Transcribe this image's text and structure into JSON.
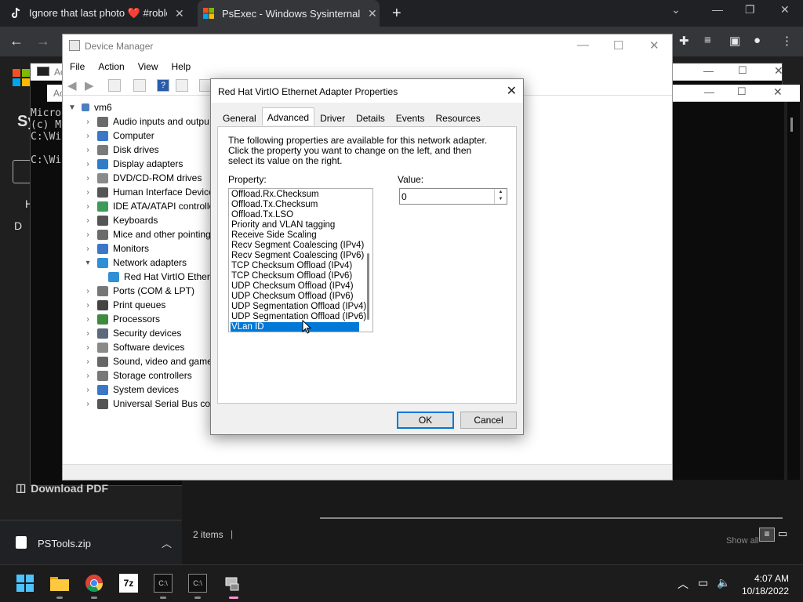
{
  "browser": {
    "tabs": [
      {
        "title": "Ignore that last photo ❤️ #roblo",
        "close": "✕"
      },
      {
        "title": "PsExec - Windows Sysinternals | M",
        "close": "✕"
      }
    ],
    "new_tab": "+"
  },
  "background": {
    "download_pdf": "Download PDF",
    "cmd_lines_1": "Micro\n(c) M\nC:\\Wi\n\nC:\\Wi",
    "cmd_title_1": "Ac",
    "cmd_title_2": "Ac",
    "explorer_status": "2 items",
    "show_all": "Show all",
    "shelf_file": "PSTools.zip",
    "sy": "Sy",
    "h": "H",
    "d": "D"
  },
  "device_manager": {
    "title": "Device Manager",
    "menu": [
      "File",
      "Action",
      "View",
      "Help"
    ],
    "tree": {
      "root": "vm6",
      "items": [
        {
          "label": "Audio inputs and outpu",
          "expanded": false
        },
        {
          "label": "Computer",
          "expanded": false
        },
        {
          "label": "Disk drives",
          "expanded": false
        },
        {
          "label": "Display adapters",
          "expanded": false
        },
        {
          "label": "DVD/CD-ROM drives",
          "expanded": false
        },
        {
          "label": "Human Interface Device",
          "expanded": false
        },
        {
          "label": "IDE ATA/ATAPI controlle",
          "expanded": false
        },
        {
          "label": "Keyboards",
          "expanded": false
        },
        {
          "label": "Mice and other pointing",
          "expanded": false
        },
        {
          "label": "Monitors",
          "expanded": false
        },
        {
          "label": "Network adapters",
          "expanded": true
        },
        {
          "label": "Red Hat VirtIO Ethern",
          "child": true
        },
        {
          "label": "Ports (COM & LPT)",
          "expanded": false
        },
        {
          "label": "Print queues",
          "expanded": false
        },
        {
          "label": "Processors",
          "expanded": false
        },
        {
          "label": "Security devices",
          "expanded": false
        },
        {
          "label": "Software devices",
          "expanded": false
        },
        {
          "label": "Sound, video and game",
          "expanded": false
        },
        {
          "label": "Storage controllers",
          "expanded": false
        },
        {
          "label": "System devices",
          "expanded": false
        },
        {
          "label": "Universal Serial Bus cont",
          "expanded": false
        }
      ]
    }
  },
  "dialog": {
    "title": "Red Hat VirtIO Ethernet Adapter Properties",
    "close": "✕",
    "tabs": [
      "General",
      "Advanced",
      "Driver",
      "Details",
      "Events",
      "Resources"
    ],
    "active_tab": "Advanced",
    "description": "The following properties are available for this network adapter. Click the property you want to change on the left, and then select its value on the right.",
    "property_label": "Property:",
    "value_label": "Value:",
    "properties": [
      "Offload.Rx.Checksum",
      "Offload.Tx.Checksum",
      "Offload.Tx.LSO",
      "Priority and VLAN tagging",
      "Receive Side Scaling",
      "Recv Segment Coalescing (IPv4)",
      "Recv Segment Coalescing (IPv6)",
      "TCP Checksum Offload (IPv4)",
      "TCP Checksum Offload (IPv6)",
      "UDP Checksum Offload (IPv4)",
      "UDP Checksum Offload (IPv6)",
      "UDP Segmentation Offload (IPv4)",
      "UDP Segmentation Offload (IPv6)",
      "VLan ID"
    ],
    "selected_property": "VLan ID",
    "value": "0",
    "ok_label": "OK",
    "cancel_label": "Cancel"
  },
  "taskbar": {
    "time": "4:07 AM",
    "date": "10/18/2022"
  },
  "colors": {
    "selection": "#0078d7",
    "taskbar": "#1c1c1c",
    "browser_dark": "#202124"
  }
}
